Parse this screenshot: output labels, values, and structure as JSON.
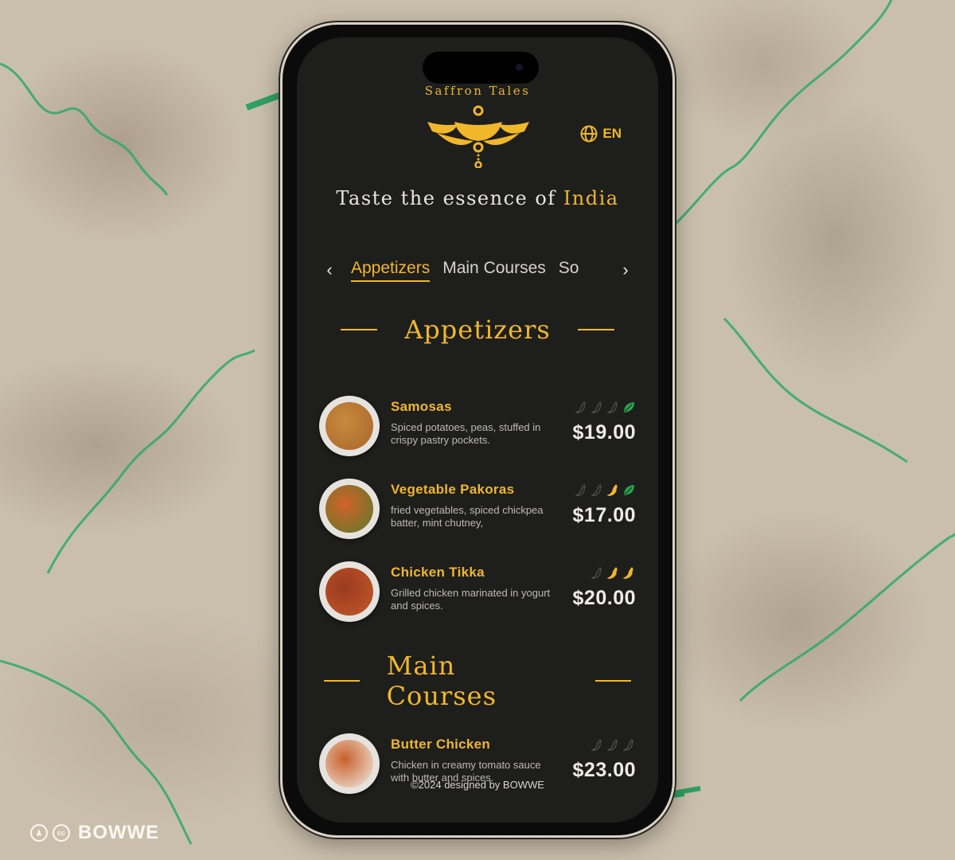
{
  "app": {
    "brand_name": "Saffron Tales",
    "language": "EN",
    "tagline_prefix": "Taste the essence of",
    "tagline_highlight": "India"
  },
  "category_nav": {
    "tabs": [
      {
        "label": "Appetizers",
        "active": true
      },
      {
        "label": "Main Courses",
        "active": false
      },
      {
        "label": "So",
        "active": false
      }
    ],
    "prev_icon": "chevron-left-icon",
    "next_icon": "chevron-right-icon"
  },
  "sections": [
    {
      "title": "Appetizers",
      "items": [
        {
          "name": "Samosas",
          "description": "Spiced potatoes, peas, stuffed in crispy pastry pockets.",
          "price": "$19.00",
          "spice_level": 0,
          "spice_max": 3,
          "vegetarian": true,
          "food_colors": [
            "#c98a3e",
            "#a8652a"
          ]
        },
        {
          "name": "Vegetable Pakoras",
          "description": "fried vegetables, spiced chickpea batter, mint chutney,",
          "price": "$17.00",
          "spice_level": 1,
          "spice_max": 3,
          "vegetarian": true,
          "food_colors": [
            "#d2622a",
            "#5a7a2a"
          ]
        },
        {
          "name": "Chicken Tikka",
          "description": "Grilled chicken marinated in yogurt and spices.",
          "price": "$20.00",
          "spice_level": 2,
          "spice_max": 3,
          "vegetarian": false,
          "food_colors": [
            "#9a3a1e",
            "#c25a2a"
          ]
        }
      ]
    },
    {
      "title": "Main Courses",
      "items": [
        {
          "name": "Butter Chicken",
          "description": "Chicken in creamy tomato sauce with butter and spices.",
          "price": "$23.00",
          "spice_level": 0,
          "spice_max": 3,
          "vegetarian": false,
          "food_colors": [
            "#c8602a",
            "#f2efe8"
          ]
        }
      ]
    }
  ],
  "footer": "©2024 designed by BOWWE",
  "watermark": {
    "text": "BOWWE",
    "badges": [
      "person-icon",
      "cc-icon"
    ]
  },
  "colors": {
    "accent": "#f0b72a",
    "screen_bg": "#1e1e1c",
    "veg_green": "#2aa34a",
    "squiggle_green": "#2ea86a"
  }
}
